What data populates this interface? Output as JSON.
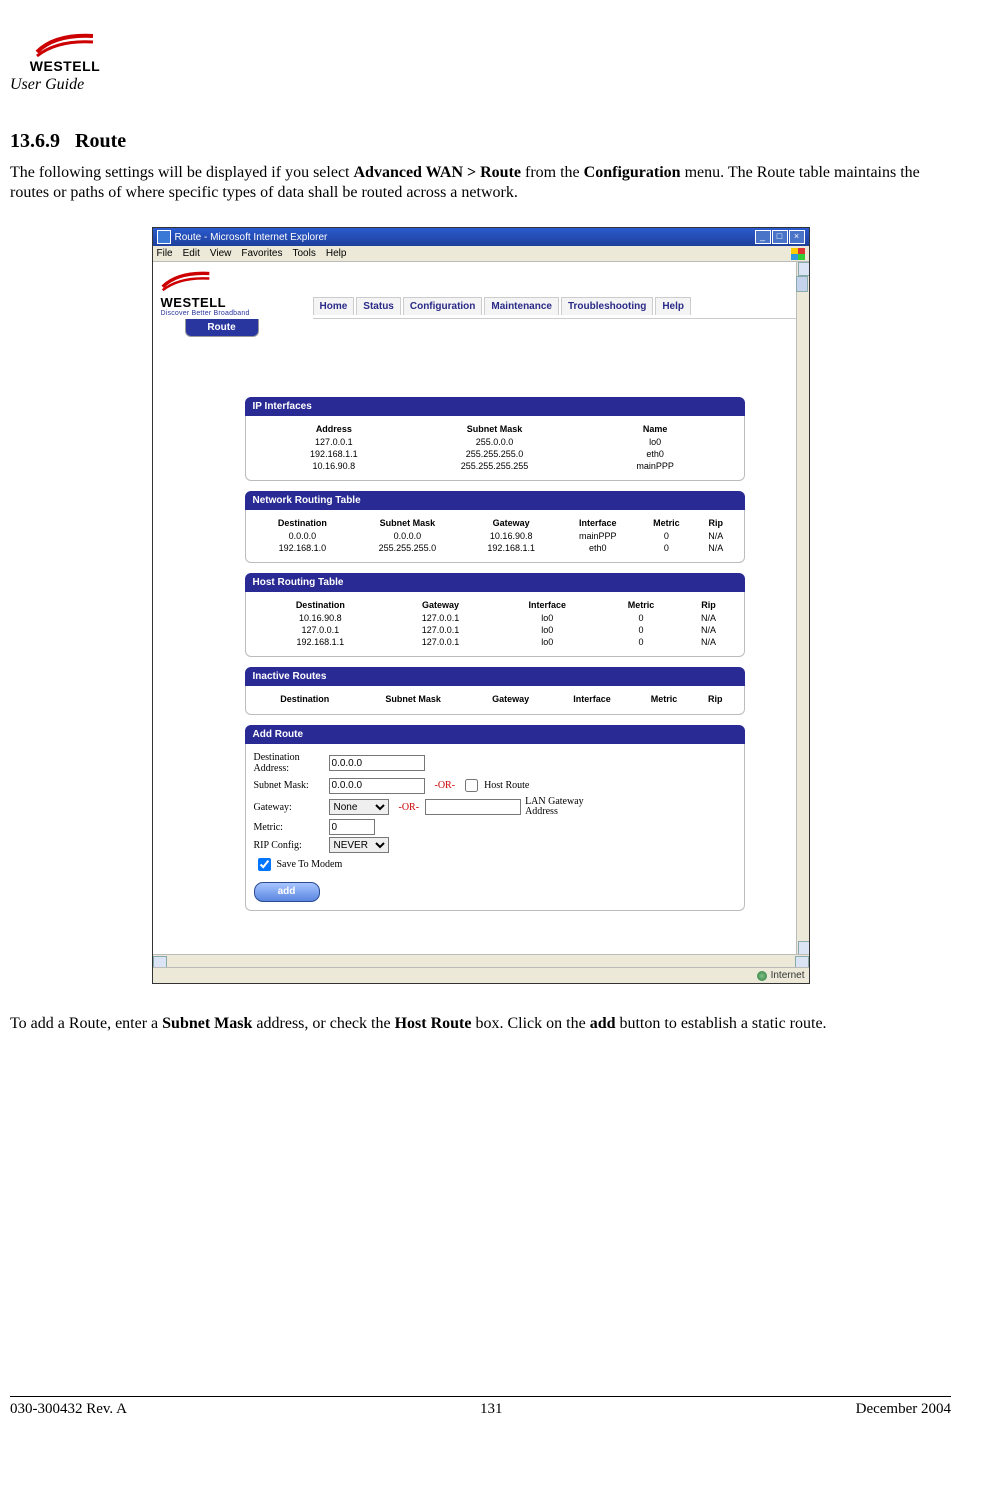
{
  "doc": {
    "logo_text": "WESTELL",
    "user_guide": "User Guide",
    "section_no": "13.6.9",
    "section_title": "Route",
    "intro_pre": "The following settings will be displayed if you select ",
    "intro_b1": "Advanced WAN > Route",
    "intro_mid": " from the ",
    "intro_b2": "Configuration",
    "intro_post": " menu. The Route table maintains the routes or paths of where specific types of data shall be routed across a network.",
    "outro_pre": "To add a Route, enter a ",
    "outro_b1": "Subnet Mask",
    "outro_mid1": " address, or check the ",
    "outro_b2": "Host Route",
    "outro_mid2": " box. Click on the ",
    "outro_b3": "add",
    "outro_post": " button to establish a static route.",
    "footer_left": "030-300432 Rev. A",
    "footer_center": "131",
    "footer_right": "December 2004"
  },
  "win": {
    "title": "Route - Microsoft Internet Explorer",
    "menus": [
      "File",
      "Edit",
      "View",
      "Favorites",
      "Tools",
      "Help"
    ],
    "status": "Internet"
  },
  "nav": {
    "tagline": "Discover Better Broadband",
    "items": [
      "Home",
      "Status",
      "Configuration",
      "Maintenance",
      "Troubleshooting",
      "Help"
    ],
    "sidetab": "Route"
  },
  "panels": {
    "ip_title": "IP Interfaces",
    "ip_headers": [
      "Address",
      "Subnet Mask",
      "Name"
    ],
    "ip_rows": [
      [
        "127.0.0.1",
        "255.0.0.0",
        "lo0"
      ],
      [
        "192.168.1.1",
        "255.255.255.0",
        "eth0"
      ],
      [
        "10.16.90.8",
        "255.255.255.255",
        "mainPPP"
      ]
    ],
    "nrt_title": "Network Routing Table",
    "nrt_headers": [
      "Destination",
      "Subnet Mask",
      "Gateway",
      "Interface",
      "Metric",
      "Rip"
    ],
    "nrt_rows": [
      [
        "0.0.0.0",
        "0.0.0.0",
        "10.16.90.8",
        "mainPPP",
        "0",
        "N/A"
      ],
      [
        "192.168.1.0",
        "255.255.255.0",
        "192.168.1.1",
        "eth0",
        "0",
        "N/A"
      ]
    ],
    "hrt_title": "Host Routing Table",
    "hrt_headers": [
      "Destination",
      "Gateway",
      "Interface",
      "Metric",
      "Rip"
    ],
    "hrt_rows": [
      [
        "10.16.90.8",
        "127.0.0.1",
        "lo0",
        "0",
        "N/A"
      ],
      [
        "127.0.0.1",
        "127.0.0.1",
        "lo0",
        "0",
        "N/A"
      ],
      [
        "192.168.1.1",
        "127.0.0.1",
        "lo0",
        "0",
        "N/A"
      ]
    ],
    "ir_title": "Inactive Routes",
    "ir_headers": [
      "Destination",
      "Subnet Mask",
      "Gateway",
      "Interface",
      "Metric",
      "Rip"
    ],
    "ar_title": "Add Route"
  },
  "form": {
    "dest_label": "Destination Address:",
    "dest_value": "0.0.0.0",
    "mask_label": "Subnet Mask:",
    "mask_value": "0.0.0.0",
    "or": "-OR-",
    "or2": "-OR-",
    "host_route": "Host Route",
    "gateway_label": "Gateway:",
    "gateway_value": "None",
    "gateway_options": [
      "None"
    ],
    "lan_gw": "LAN Gateway Address",
    "metric_label": "Metric:",
    "metric_value": "0",
    "rip_label": "RIP Config:",
    "rip_value": "NEVER",
    "rip_options": [
      "NEVER"
    ],
    "save_label": "Save To Modem",
    "add_label": "add"
  }
}
